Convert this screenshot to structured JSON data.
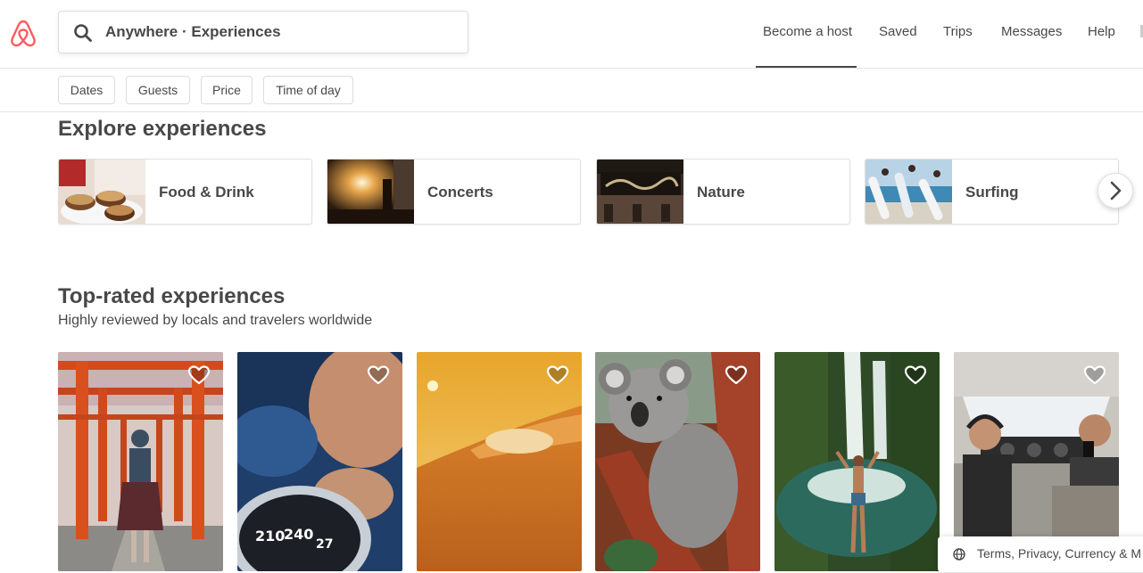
{
  "header": {
    "search_value": "Anywhere · Experiences",
    "nav": [
      "Become a host",
      "Saved",
      "Trips",
      "Messages",
      "Help"
    ],
    "brand_color": "#ff5a5f"
  },
  "filters": [
    "Dates",
    "Guests",
    "Price",
    "Time of day"
  ],
  "explore": {
    "title": "Explore experiences",
    "categories": [
      {
        "label": "Food & Drink",
        "icon": "food-photo"
      },
      {
        "label": "Concerts",
        "icon": "concert-photo"
      },
      {
        "label": "Nature",
        "icon": "harry-potter-theatre-photo"
      },
      {
        "label": "Surfing",
        "icon": "surfers-photo"
      }
    ]
  },
  "top_rated": {
    "title": "Top-rated experiences",
    "subtitle": "Highly reviewed by locals and travelers worldwide",
    "cards": [
      {
        "image": "torii-gates-photo"
      },
      {
        "image": "compass-photo"
      },
      {
        "image": "desert-dunes-photo"
      },
      {
        "image": "koala-photo"
      },
      {
        "image": "waterfall-photo"
      },
      {
        "image": "airplane-cockpit-photo"
      }
    ]
  },
  "footer": {
    "text": "Terms, Privacy, Currency & M"
  }
}
